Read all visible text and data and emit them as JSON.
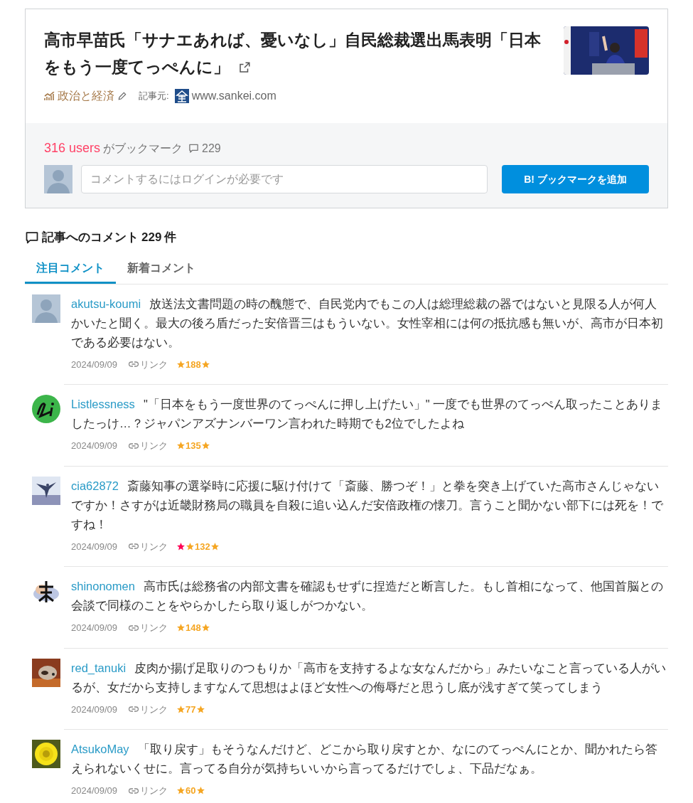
{
  "article": {
    "title": "高市早苗氏「サナエあれば、憂いなし」自民総裁選出馬表明「日本をもう一度てっぺんに」",
    "category": "政治と経済",
    "source_label": "記事元:",
    "source": "www.sankei.com"
  },
  "bookmark": {
    "users": "316 users",
    "users_suffix": "がブックマーク",
    "comment_count": "229",
    "comment_placeholder": "コメントするにはログインが必要です",
    "add_button": "B! ブックマークを追加"
  },
  "comments_section": {
    "heading": "記事へのコメント",
    "count": "229",
    "unit": "件",
    "tabs": [
      {
        "label": "注目コメント",
        "selected": true
      },
      {
        "label": "新着コメント",
        "selected": false
      }
    ]
  },
  "comments": [
    {
      "user": "akutsu-koumi",
      "avatar": {
        "kind": "silhouette"
      },
      "text": "放送法文書問題の時の醜態で、自民党内でもこの人は総理総裁の器ではないと見限る人が何人かいたと聞く。最大の後ろ盾だった安倍晋三はもういない。女性宰相には何の抵抗感も無いが、高市が日本初である必要はない。",
      "date": "2024/09/09",
      "link": "リンク",
      "star_marks": [
        {
          "color": "#f5a623"
        }
      ],
      "star_count": "188"
    },
    {
      "user": "Listlessness",
      "avatar": {
        "kind": "badge"
      },
      "text": "\"「日本をもう一度世界のてっぺんに押し上げたい」\" 一度でも世界のてっぺん取ったことありましたっけ…？ジャパンアズナンバーワン言われた時期でも2位でしたよね",
      "date": "2024/09/09",
      "link": "リンク",
      "star_marks": [
        {
          "color": "#f5a623"
        }
      ],
      "star_count": "135"
    },
    {
      "user": "cia62872",
      "avatar": {
        "kind": "skater"
      },
      "text": "斎藤知事の選挙時に応援に駆け付けて「斎藤、勝つぞ！」と拳を突き上げていた高市さんじゃないですか！さすがは近畿財務局の職員を自殺に追い込んだ安倍政権の懐刀。言うこと聞かない部下には死を！ですね！",
      "date": "2024/09/09",
      "link": "リンク",
      "star_marks": [
        {
          "color": "#ff0055"
        },
        {
          "color": "#f5a623"
        }
      ],
      "star_count": "132"
    },
    {
      "user": "shinonomen",
      "avatar": {
        "kind": "cloud"
      },
      "text": "高市氏は総務省の内部文書を確認もせずに捏造だと断言した。もし首相になって、他国首脳との会談で同様のことをやらかしたら取り返しがつかない。",
      "date": "2024/09/09",
      "link": "リンク",
      "star_marks": [
        {
          "color": "#f5a623"
        }
      ],
      "star_count": "148"
    },
    {
      "user": "red_tanuki",
      "avatar": {
        "kind": "animal"
      },
      "text": "皮肉か揚げ足取りのつもりか「高市を支持するよな女なんだから」みたいなこと言っている人がいるが、女だから支持しますなんて思想はよほど女性への侮辱だと思うし底が浅すぎて笑ってしまう",
      "date": "2024/09/09",
      "link": "リンク",
      "star_marks": [
        {
          "color": "#f5a623"
        }
      ],
      "star_count": "77"
    },
    {
      "user": "AtsukoMay",
      "avatar": {
        "kind": "flower"
      },
      "text": "「取り戻す」もそうなんだけど、どこから取り戻すとか、なにのてっぺんにとか、聞かれたら答えられないくせに。言ってる自分が気持ちいいから言ってるだけでしょ、下品だなぁ。",
      "date": "2024/09/09",
      "link": "リンク",
      "star_marks": [
        {
          "color": "#f5a623"
        }
      ],
      "star_count": "60"
    }
  ]
}
